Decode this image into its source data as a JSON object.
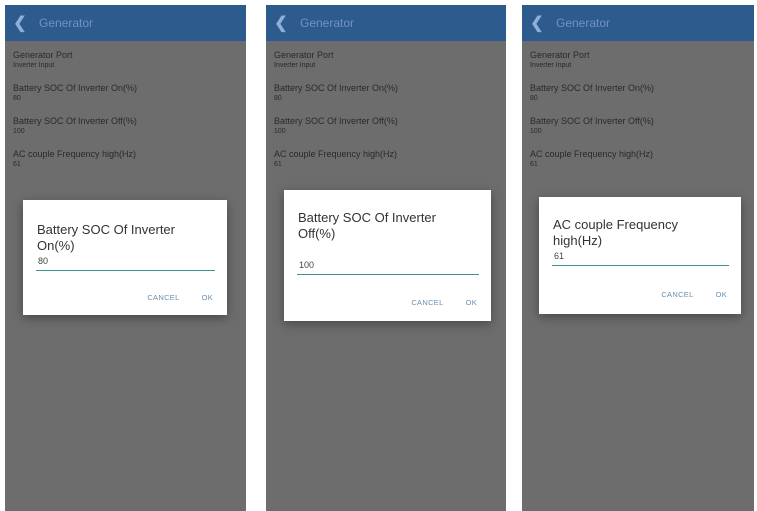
{
  "panels": [
    {
      "header": {
        "title": "Generator"
      },
      "settings": [
        {
          "label": "Generator Port",
          "value": "Inverter Input"
        },
        {
          "label": "Battery SOC Of Inverter On(%)",
          "value": "80"
        },
        {
          "label": "Battery SOC Of Inverter Off(%)",
          "value": "100"
        },
        {
          "label": "AC couple Frequency high(Hz)",
          "value": "61"
        }
      ],
      "dialog": {
        "title": "Battery SOC Of Inverter On(%)",
        "input_value": "80",
        "cancel_label": "CANCEL",
        "ok_label": "OK"
      }
    },
    {
      "header": {
        "title": "Generator"
      },
      "settings": [
        {
          "label": "Generator Port",
          "value": "Inverter Input"
        },
        {
          "label": "Battery SOC Of Inverter On(%)",
          "value": "80"
        },
        {
          "label": "Battery SOC Of Inverter Off(%)",
          "value": "100"
        },
        {
          "label": "AC couple Frequency high(Hz)",
          "value": "61"
        }
      ],
      "dialog": {
        "title": "Battery SOC Of Inverter Off(%)",
        "input_value": "100",
        "cancel_label": "CANCEL",
        "ok_label": "OK"
      }
    },
    {
      "header": {
        "title": "Generator"
      },
      "settings": [
        {
          "label": "Generator Port",
          "value": "Inverter Input"
        },
        {
          "label": "Battery SOC Of Inverter On(%)",
          "value": "80"
        },
        {
          "label": "Battery SOC Of Inverter Off(%)",
          "value": "100"
        },
        {
          "label": "AC couple Frequency high(Hz)",
          "value": "61"
        }
      ],
      "dialog": {
        "title": "AC couple Frequency high(Hz)",
        "input_value": "61",
        "cancel_label": "CANCEL",
        "ok_label": "OK"
      }
    }
  ],
  "colors": {
    "appbar": "#2e5b8e",
    "scrim": "#6d6d6d",
    "accent": "#3f8f8b",
    "button_text": "#6a8fb0"
  },
  "icons": {
    "back": "chevron-left-icon"
  }
}
